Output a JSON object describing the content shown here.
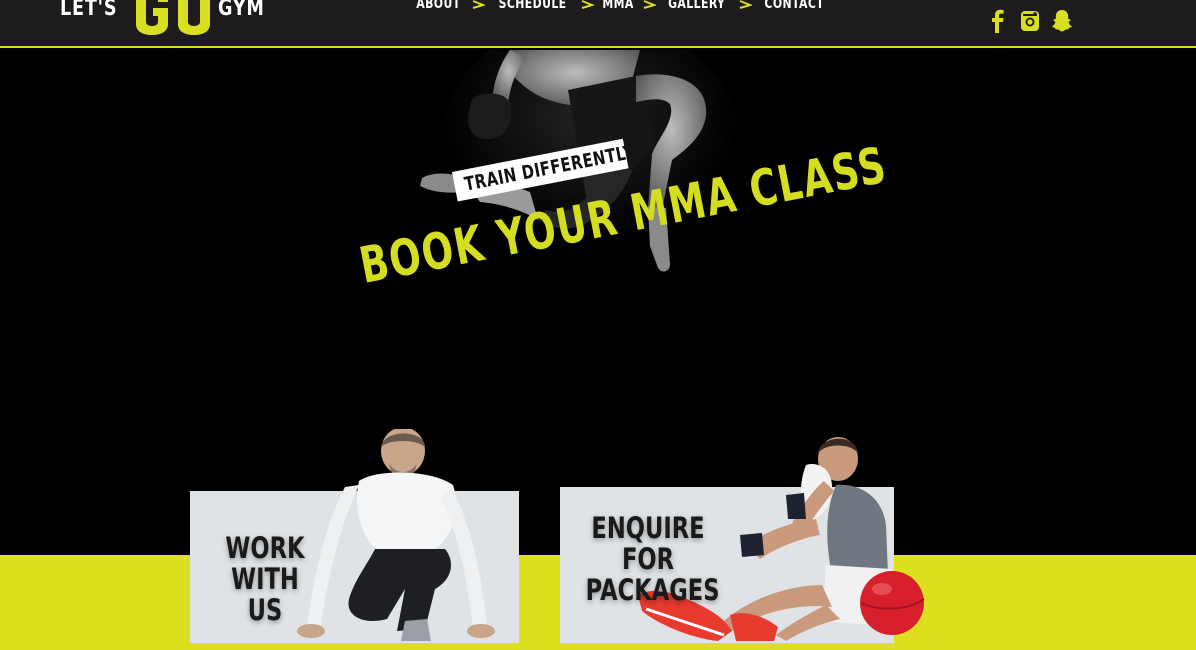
{
  "header": {
    "logo": {
      "lets": "LET'S",
      "go": "GO",
      "gym": "GYM"
    },
    "nav": [
      "ABOUT",
      "SCHEDULE",
      "MMA",
      "GALLERY",
      "CONTACT"
    ],
    "social": [
      "facebook-icon",
      "instagram-icon",
      "snapchat-icon"
    ]
  },
  "hero": {
    "tagline": "TRAIN DIFFERENTLY",
    "headline": "BOOK YOUR MMA CLASS"
  },
  "cards": {
    "work": "WORK\nWITH US",
    "enquire": "ENQUIRE FOR\nPACKAGES"
  },
  "colors": {
    "accent": "#d9e021",
    "header_bg": "#1e1b1c",
    "hero_bg": "#000000",
    "card_bg": "#dfe3e5"
  }
}
